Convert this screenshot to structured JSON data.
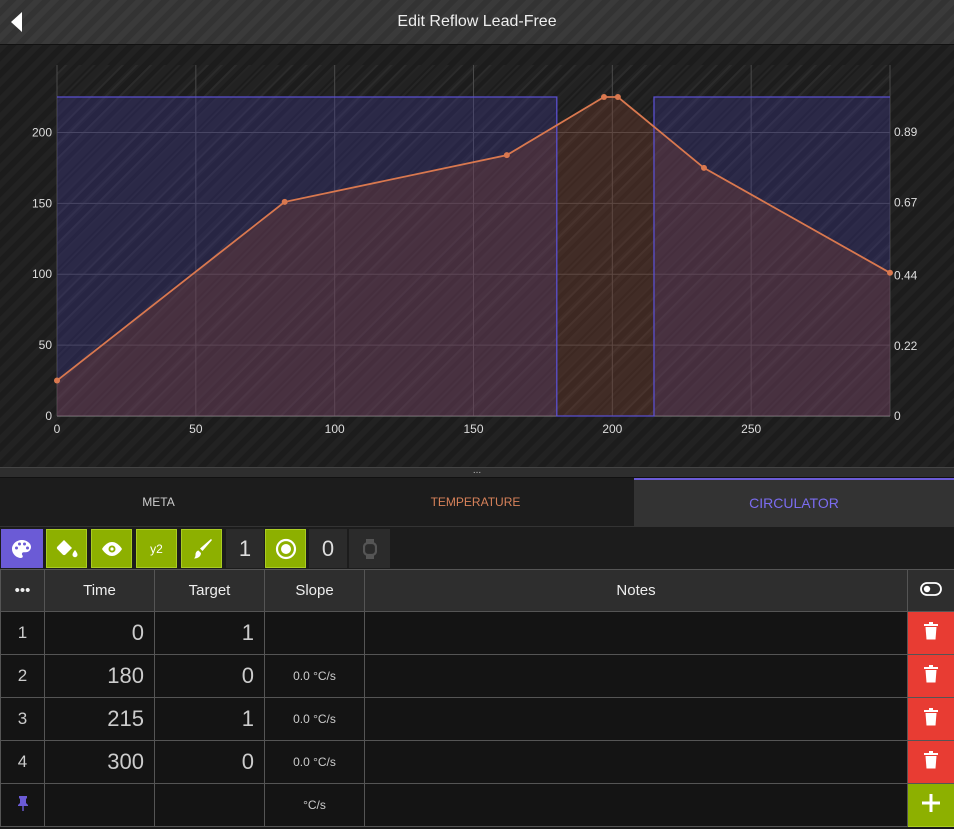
{
  "header": {
    "title": "Edit Reflow Lead-Free"
  },
  "chart_data": {
    "type": "line",
    "x_ticks": [
      "0",
      "50",
      "100",
      "150",
      "200",
      "250"
    ],
    "y_ticks_left": [
      "0",
      "50",
      "100",
      "150",
      "200"
    ],
    "y_ticks_right": [
      "0",
      "0.22",
      "0.44",
      "0.67",
      "0.89"
    ],
    "xlim": [
      0,
      300
    ],
    "ylim_left": [
      0,
      240
    ],
    "grid": true,
    "series": [
      {
        "name": "",
        "type": "line",
        "color": "#d9784f",
        "points": [
          [
            0,
            25
          ],
          [
            82,
            151
          ],
          [
            162,
            184
          ],
          [
            197,
            225
          ],
          [
            202,
            225
          ],
          [
            233,
            175
          ],
          [
            300,
            101
          ]
        ]
      },
      {
        "name": "",
        "type": "step",
        "color": "#5a4fcf",
        "segments": [
          [
            0,
            180,
            1
          ],
          [
            180,
            215,
            0
          ],
          [
            215,
            300,
            1
          ]
        ]
      }
    ]
  },
  "splitter": {
    "glyph": "..."
  },
  "tabs": [
    {
      "label": "META"
    },
    {
      "label": "TEMPERATURE"
    },
    {
      "label": "CIRCULATOR",
      "active": true
    }
  ],
  "toolbar": {
    "count_a": "1",
    "count_b": "0",
    "y2_label": "y2",
    "icons": [
      "palette-icon",
      "fill-bucket-icon",
      "eye-icon",
      "y2",
      "brush-icon",
      "record-icon",
      "watch-icon"
    ]
  },
  "table": {
    "menu_glyph": "•••",
    "headers": {
      "time": "Time",
      "target": "Target",
      "slope": "Slope",
      "notes": "Notes"
    },
    "rows": [
      {
        "index": "1",
        "time": "0",
        "target": "1",
        "slope": "",
        "notes": ""
      },
      {
        "index": "2",
        "time": "180",
        "target": "0",
        "slope": "0.0 °C/s",
        "notes": ""
      },
      {
        "index": "3",
        "time": "215",
        "target": "1",
        "slope": "0.0 °C/s",
        "notes": ""
      },
      {
        "index": "4",
        "time": "300",
        "target": "0",
        "slope": "0.0 °C/s",
        "notes": ""
      }
    ],
    "footer_slope_unit": "°C/s"
  },
  "colors": {
    "accent_purple": "#6b5bd6",
    "accent_green": "#8db000",
    "delete_red": "#e83c33",
    "temperature_orange": "#d9784f"
  }
}
